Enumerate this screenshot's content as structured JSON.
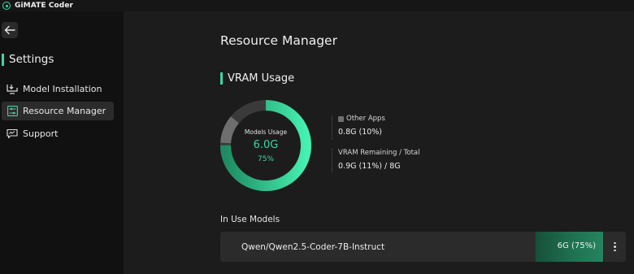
{
  "app": {
    "title": "GiMATE Coder"
  },
  "sidebar": {
    "heading": "Settings",
    "items": [
      {
        "label": "Model Installation",
        "icon": "download-monitor-icon",
        "active": false
      },
      {
        "label": "Resource Manager",
        "icon": "sliders-icon",
        "active": true
      },
      {
        "label": "Support",
        "icon": "support-chat-icon",
        "active": false
      }
    ]
  },
  "main": {
    "page_title": "Resource Manager",
    "vram": {
      "section_title": "VRAM Usage",
      "center_label": "Models Usage",
      "center_value": "6.0G",
      "center_pct": "75%",
      "other_apps_label": "Other Apps",
      "other_apps_value": "0.8G (10%)",
      "remaining_label": "VRAM Remaining / Total",
      "remaining_value": "0.9G (11%) / 8G",
      "models_fraction": 0.75,
      "other_fraction": 0.1
    },
    "in_use": {
      "title": "In Use Models",
      "models": [
        {
          "name": "Qwen/Qwen2.5-Coder-7B-Instruct",
          "usage": "6G (75%)"
        }
      ]
    }
  },
  "colors": {
    "accent": "#3ed6a0",
    "other_apps": "#6e6e6e",
    "ring_track": "#3a3a3a"
  }
}
